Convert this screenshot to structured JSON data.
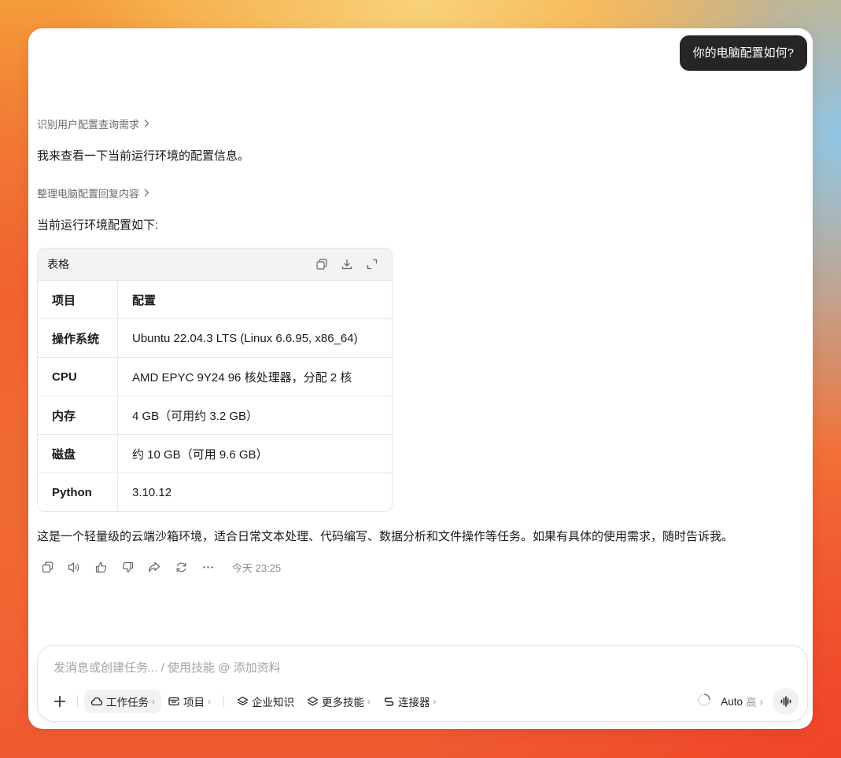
{
  "user_message": "你的电脑配置如何?",
  "thought_1": "识别用户配置查询需求",
  "reply_1": "我来查看一下当前运行环境的配置信息。",
  "thought_2": "整理电脑配置回复内容",
  "reply_2": "当前运行环境配置如下:",
  "table": {
    "title": "表格",
    "headers": [
      "项目",
      "配置"
    ],
    "rows": [
      [
        "操作系统",
        "Ubuntu 22.04.3 LTS (Linux 6.6.95, x86_64)"
      ],
      [
        "CPU",
        "AMD EPYC 9Y24 96 核处理器，分配 2 核"
      ],
      [
        "内存",
        "4 GB（可用约 3.2 GB）"
      ],
      [
        "磁盘",
        "约 10 GB（可用 9.6 GB）"
      ],
      [
        "Python",
        "3.10.12"
      ]
    ],
    "tools": [
      "copy-icon",
      "download-icon",
      "expand-icon"
    ]
  },
  "summary": "这是一个轻量级的云端沙箱环境，适合日常文本处理、代码编写、数据分析和文件操作等任务。如果有具体的使用需求，随时告诉我。",
  "message_actions": [
    "copy-icon",
    "speaker-icon",
    "thumbs-up-icon",
    "thumbs-down-icon",
    "share-icon",
    "regenerate-icon",
    "more-icon"
  ],
  "timestamp": "今天 23:25",
  "composer": {
    "placeholder": "发消息或创建任务... / 使用技能 @ 添加资料",
    "chips": {
      "work_task": "工作任务",
      "project": "项目",
      "enterprise_knowledge": "企业知识",
      "more_skills": "更多技能",
      "connectors": "连接器"
    },
    "model": "Auto",
    "model_level": "高",
    "chevron": "›"
  }
}
